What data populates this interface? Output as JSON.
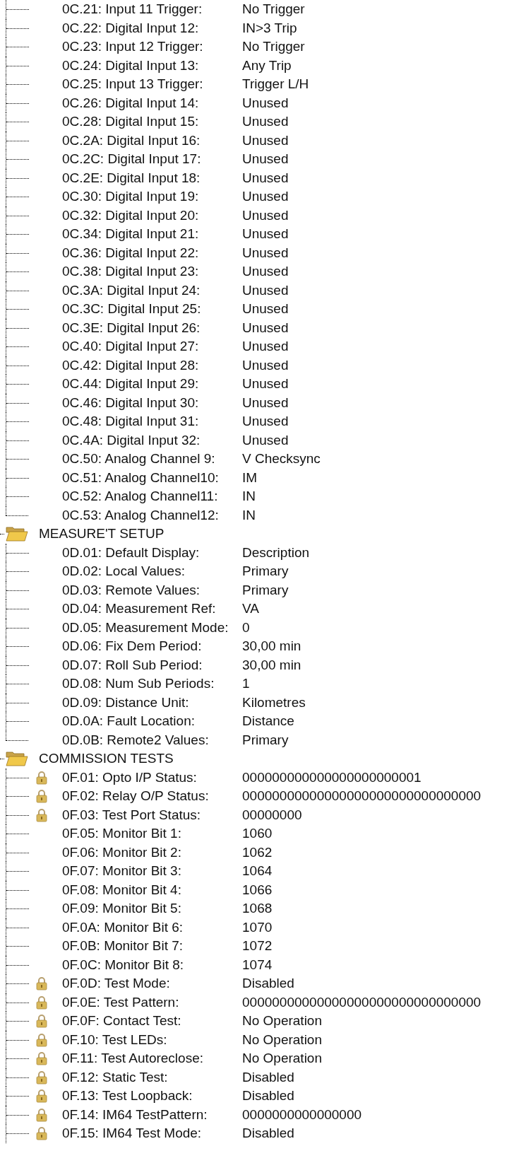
{
  "tree": {
    "nodes": [
      {
        "kind": "continued",
        "children": [
          {
            "label": "0C.21: Input 11 Trigger:",
            "value": "No Trigger",
            "locked": false
          },
          {
            "label": "0C.22: Digital Input 12:",
            "value": "IN>3 Trip",
            "locked": false
          },
          {
            "label": "0C.23: Input 12 Trigger:",
            "value": "No Trigger",
            "locked": false
          },
          {
            "label": "0C.24: Digital Input 13:",
            "value": "Any Trip",
            "locked": false
          },
          {
            "label": "0C.25: Input 13 Trigger:",
            "value": "Trigger L/H",
            "locked": false
          },
          {
            "label": "0C.26: Digital Input 14:",
            "value": "Unused",
            "locked": false
          },
          {
            "label": "0C.28: Digital Input 15:",
            "value": "Unused",
            "locked": false
          },
          {
            "label": "0C.2A: Digital Input 16:",
            "value": "Unused",
            "locked": false
          },
          {
            "label": "0C.2C: Digital Input 17:",
            "value": "Unused",
            "locked": false
          },
          {
            "label": "0C.2E: Digital Input 18:",
            "value": "Unused",
            "locked": false
          },
          {
            "label": "0C.30: Digital Input 19:",
            "value": "Unused",
            "locked": false
          },
          {
            "label": "0C.32: Digital Input 20:",
            "value": "Unused",
            "locked": false
          },
          {
            "label": "0C.34: Digital Input 21:",
            "value": "Unused",
            "locked": false
          },
          {
            "label": "0C.36: Digital Input 22:",
            "value": "Unused",
            "locked": false
          },
          {
            "label": "0C.38: Digital Input 23:",
            "value": "Unused",
            "locked": false
          },
          {
            "label": "0C.3A: Digital Input 24:",
            "value": "Unused",
            "locked": false
          },
          {
            "label": "0C.3C: Digital Input 25:",
            "value": "Unused",
            "locked": false
          },
          {
            "label": "0C.3E: Digital Input 26:",
            "value": "Unused",
            "locked": false
          },
          {
            "label": "0C.40: Digital Input 27:",
            "value": "Unused",
            "locked": false
          },
          {
            "label": "0C.42: Digital Input 28:",
            "value": "Unused",
            "locked": false
          },
          {
            "label": "0C.44: Digital Input 29:",
            "value": "Unused",
            "locked": false
          },
          {
            "label": "0C.46: Digital Input 30:",
            "value": "Unused",
            "locked": false
          },
          {
            "label": "0C.48: Digital Input 31:",
            "value": "Unused",
            "locked": false
          },
          {
            "label": "0C.4A: Digital Input 32:",
            "value": "Unused",
            "locked": false
          },
          {
            "label": "0C.50: Analog Channel 9:",
            "value": "V Checksync",
            "locked": false
          },
          {
            "label": "0C.51: Analog Channel10:",
            "value": "IM",
            "locked": false
          },
          {
            "label": "0C.52: Analog Channel11:",
            "value": "IN",
            "locked": false
          },
          {
            "label": "0C.53: Analog Channel12:",
            "value": "IN",
            "locked": false
          }
        ]
      },
      {
        "kind": "folder",
        "label": "MEASURE'T SETUP",
        "expanded": true,
        "children": [
          {
            "label": "0D.01: Default Display:",
            "value": "Description",
            "locked": false
          },
          {
            "label": "0D.02: Local Values:",
            "value": "Primary",
            "locked": false
          },
          {
            "label": "0D.03: Remote Values:",
            "value": "Primary",
            "locked": false
          },
          {
            "label": "0D.04: Measurement Ref:",
            "value": "VA",
            "locked": false
          },
          {
            "label": "0D.05: Measurement Mode:",
            "value": "0",
            "locked": false
          },
          {
            "label": "0D.06: Fix Dem Period:",
            "value": "30,00 min",
            "locked": false
          },
          {
            "label": "0D.07: Roll Sub Period:",
            "value": "30,00 min",
            "locked": false
          },
          {
            "label": "0D.08: Num Sub Periods:",
            "value": "1",
            "locked": false
          },
          {
            "label": "0D.09: Distance Unit:",
            "value": "Kilometres",
            "locked": false
          },
          {
            "label": "0D.0A: Fault Location:",
            "value": "Distance",
            "locked": false
          },
          {
            "label": "0D.0B: Remote2 Values:",
            "value": "Primary",
            "locked": false
          }
        ]
      },
      {
        "kind": "folder",
        "label": "COMMISSION TESTS",
        "expanded": true,
        "children": [
          {
            "label": "0F.01: Opto I/P Status:",
            "value": "000000000000000000000001",
            "locked": true
          },
          {
            "label": "0F.02: Relay O/P Status:",
            "value": "00000000000000000000000000000000",
            "locked": true
          },
          {
            "label": "0F.03: Test Port Status:",
            "value": "00000000",
            "locked": true
          },
          {
            "label": "0F.05: Monitor Bit 1:",
            "value": "1060",
            "locked": false
          },
          {
            "label": "0F.06: Monitor Bit 2:",
            "value": "1062",
            "locked": false
          },
          {
            "label": "0F.07: Monitor Bit 3:",
            "value": "1064",
            "locked": false
          },
          {
            "label": "0F.08: Monitor Bit 4:",
            "value": "1066",
            "locked": false
          },
          {
            "label": "0F.09: Monitor Bit 5:",
            "value": "1068",
            "locked": false
          },
          {
            "label": "0F.0A: Monitor Bit 6:",
            "value": "1070",
            "locked": false
          },
          {
            "label": "0F.0B: Monitor Bit 7:",
            "value": "1072",
            "locked": false
          },
          {
            "label": "0F.0C: Monitor Bit 8:",
            "value": "1074",
            "locked": false
          },
          {
            "label": "0F.0D: Test Mode:",
            "value": "Disabled",
            "locked": true
          },
          {
            "label": "0F.0E: Test Pattern:",
            "value": "00000000000000000000000000000000",
            "locked": true
          },
          {
            "label": "0F.0F: Contact Test:",
            "value": "No Operation",
            "locked": true
          },
          {
            "label": "0F.10: Test LEDs:",
            "value": "No Operation",
            "locked": true
          },
          {
            "label": "0F.11: Test Autoreclose:",
            "value": "No Operation",
            "locked": true
          },
          {
            "label": "0F.12: Static Test:",
            "value": "Disabled",
            "locked": true
          },
          {
            "label": "0F.13: Test Loopback:",
            "value": "Disabled",
            "locked": true
          },
          {
            "label": "0F.14: IM64 TestPattern:",
            "value": "0000000000000000",
            "locked": true
          },
          {
            "label": "0F.15: IM64 Test Mode:",
            "value": "Disabled",
            "locked": true
          }
        ]
      }
    ]
  }
}
